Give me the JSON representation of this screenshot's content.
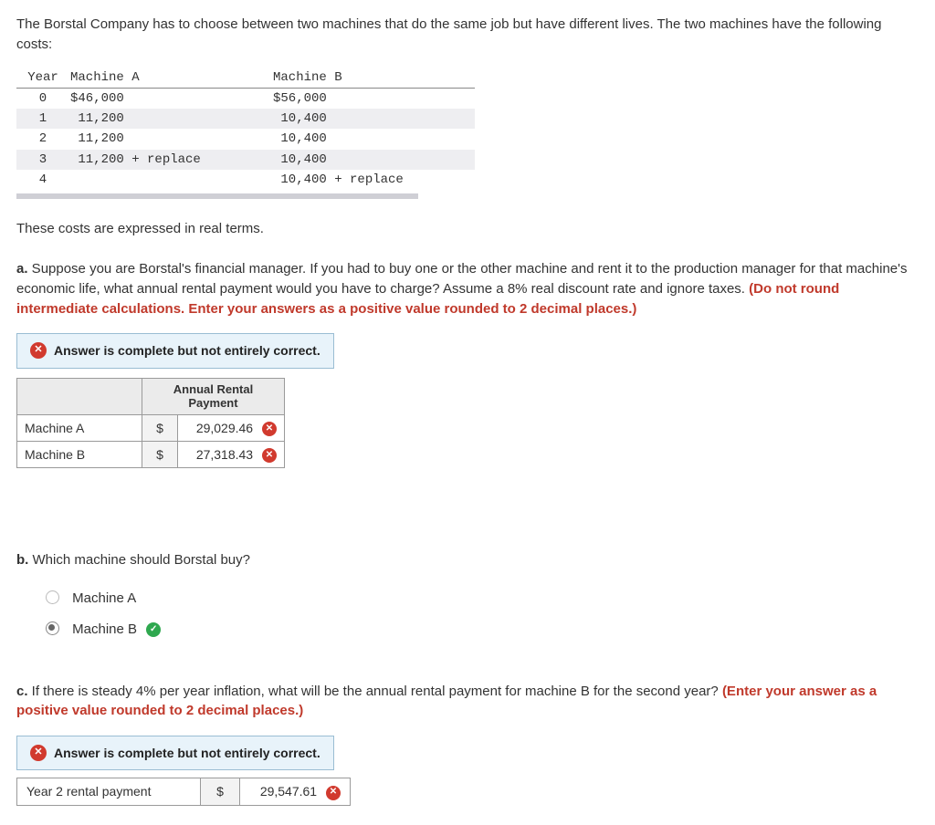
{
  "intro": "The Borstal Company has to choose between two machines that do the same job but have different lives. The two machines have the following costs:",
  "costs_table": {
    "headers": {
      "year": "Year",
      "a": "Machine A",
      "b": "Machine B"
    },
    "rows": [
      {
        "year": "0",
        "a": "$46,000",
        "b": "$56,000"
      },
      {
        "year": "1",
        "a": " 11,200",
        "b": " 10,400"
      },
      {
        "year": "2",
        "a": " 11,200",
        "b": " 10,400"
      },
      {
        "year": "3",
        "a": " 11,200 + replace",
        "b": " 10,400"
      },
      {
        "year": "4",
        "a": "",
        "b": " 10,400 + replace"
      }
    ]
  },
  "real_terms": "These costs are expressed in real terms.",
  "part_a": {
    "label": "a.",
    "text": " Suppose you are Borstal's financial manager. If you had to buy one or the other machine and rent it to the production manager for that machine's economic life, what annual rental payment would you have to charge? Assume a 8% real discount rate and ignore taxes. ",
    "red": "(Do not round intermediate calculations. Enter your answers as a positive value rounded to 2 decimal places.)"
  },
  "feedback": "Answer is complete but not entirely correct.",
  "answer_table": {
    "header": "Annual Rental Payment",
    "rows": [
      {
        "label": "Machine A",
        "currency": "$",
        "value": "29,029.46",
        "status": "wrong"
      },
      {
        "label": "Machine B",
        "currency": "$",
        "value": "27,318.43",
        "status": "wrong"
      }
    ]
  },
  "part_b": {
    "label": "b.",
    "text": " Which machine should Borstal buy?",
    "choices": [
      {
        "label": "Machine A",
        "selected": false,
        "status": "none"
      },
      {
        "label": "Machine B",
        "selected": true,
        "status": "correct"
      }
    ]
  },
  "part_c": {
    "label": "c.",
    "text": " If there is steady 4% per year inflation, what will be the annual rental payment for machine B for the second year? ",
    "red": "(Enter your answer as a positive value rounded to 2 decimal places.)"
  },
  "answer_c": {
    "label": "Year 2 rental payment",
    "currency": "$",
    "value": "29,547.61",
    "status": "wrong"
  },
  "glyphs": {
    "x": "✕",
    "check": "✓"
  }
}
